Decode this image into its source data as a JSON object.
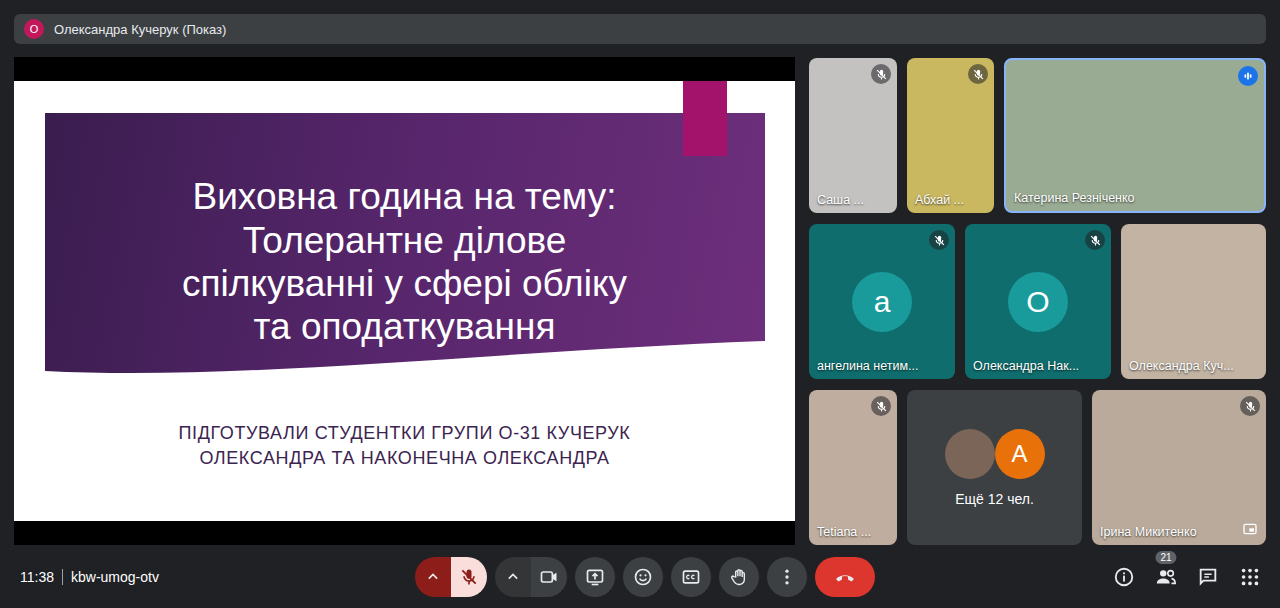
{
  "presenter_bar": {
    "avatar": "О",
    "label": "Олександра Кучерук (Показ)"
  },
  "slide": {
    "title_lines": [
      "Виховна година на тему:",
      "Толерантне ділове",
      "спілкуванні у сфері обліку",
      "та оподаткування"
    ],
    "subtitle_lines": [
      "ПІДГОТУВАЛИ СТУДЕНТКИ ГРУПИ О-31 КУЧЕРУК",
      "ОЛЕКСАНДРА ТА НАКОНЕЧНА ОЛЕКСАНДРА"
    ]
  },
  "tile_rows": [
    [
      {
        "kind": "video",
        "name": "Саша ...",
        "muted": true,
        "speaking": false,
        "color": "#c4c2c0"
      },
      {
        "kind": "video",
        "name": "Абхай ...",
        "muted": true,
        "speaking": false,
        "color": "#c9b860"
      },
      {
        "kind": "video",
        "name": "Катерина Резніченко",
        "muted": false,
        "speaking": true,
        "color": "#9aab94"
      }
    ],
    [
      {
        "kind": "avatar",
        "name": "ангелина нетим...",
        "letter": "а",
        "muted": true,
        "speaking": false,
        "color": "#1a9b9b"
      },
      {
        "kind": "avatar",
        "name": "Олександра Нак...",
        "letter": "О",
        "muted": true,
        "speaking": false,
        "color": "#1a9b9b"
      },
      {
        "kind": "video",
        "name": "Олександра Куч...",
        "muted": false,
        "speaking": false,
        "color": "#c2b3a3"
      }
    ],
    [
      {
        "kind": "video",
        "name": "Tetiana ...",
        "muted": true,
        "speaking": false,
        "color": "#bfae9f"
      },
      {
        "kind": "overflow",
        "name": "Ещё 12 чел.",
        "letter": "А",
        "muted": false,
        "speaking": false,
        "color": "#e8710a"
      },
      {
        "kind": "video",
        "name": "Ірина Микитенко",
        "muted": true,
        "speaking": false,
        "color": "#b9aa9b"
      }
    ]
  ],
  "meeting": {
    "time": "11:38",
    "code": "kbw-umog-otv"
  },
  "controls": [
    {
      "kind": "mic",
      "off": true
    },
    {
      "kind": "camera",
      "off": false
    },
    {
      "kind": "present",
      "off": false
    },
    {
      "kind": "reactions",
      "off": false
    },
    {
      "kind": "captions",
      "off": false
    },
    {
      "kind": "hand",
      "off": false
    },
    {
      "kind": "more",
      "off": false
    },
    {
      "kind": "end",
      "off": false
    }
  ],
  "right_controls": [
    {
      "kind": "info"
    },
    {
      "kind": "people",
      "badge": "21"
    },
    {
      "kind": "chat"
    },
    {
      "kind": "activities"
    }
  ]
}
